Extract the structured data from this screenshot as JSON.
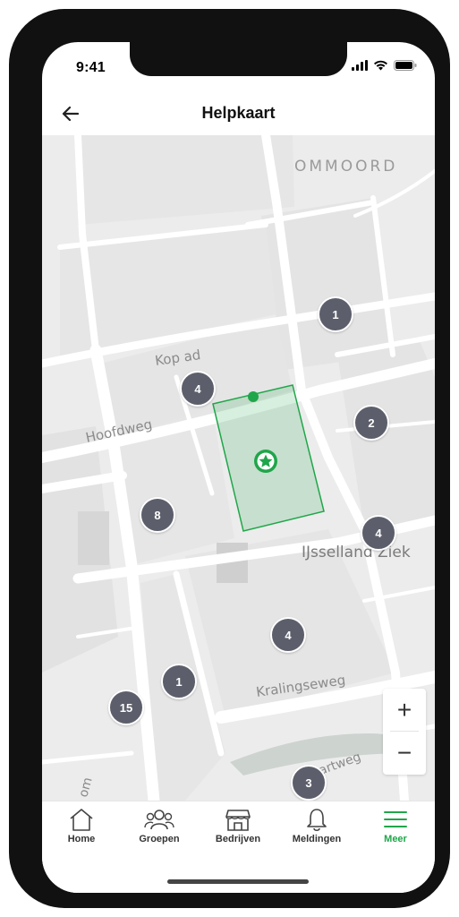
{
  "status_bar": {
    "time": "9:41"
  },
  "header": {
    "title": "Helpkaart"
  },
  "map": {
    "labels": {
      "district": "OMMOORD",
      "street_1": "Kop  ad",
      "street_2": "Hoofdweg",
      "hospital": "IJsselland Ziek",
      "street_3": "Kralingseweg",
      "street_4": "R       aartweg",
      "street_5": "om"
    },
    "clusters": [
      "1",
      "4",
      "2",
      "8",
      "4",
      "4",
      "1",
      "15",
      "3"
    ],
    "accent": "#1fa64a",
    "cluster_color": "#5c5f6b"
  },
  "zoom": {
    "in": "+",
    "out": "−"
  },
  "tabs": [
    {
      "label": "Home",
      "icon": "home-icon"
    },
    {
      "label": "Groepen",
      "icon": "groups-icon"
    },
    {
      "label": "Bedrijven",
      "icon": "store-icon"
    },
    {
      "label": "Meldingen",
      "icon": "bell-icon"
    },
    {
      "label": "Meer",
      "icon": "menu-icon",
      "active": true
    }
  ]
}
